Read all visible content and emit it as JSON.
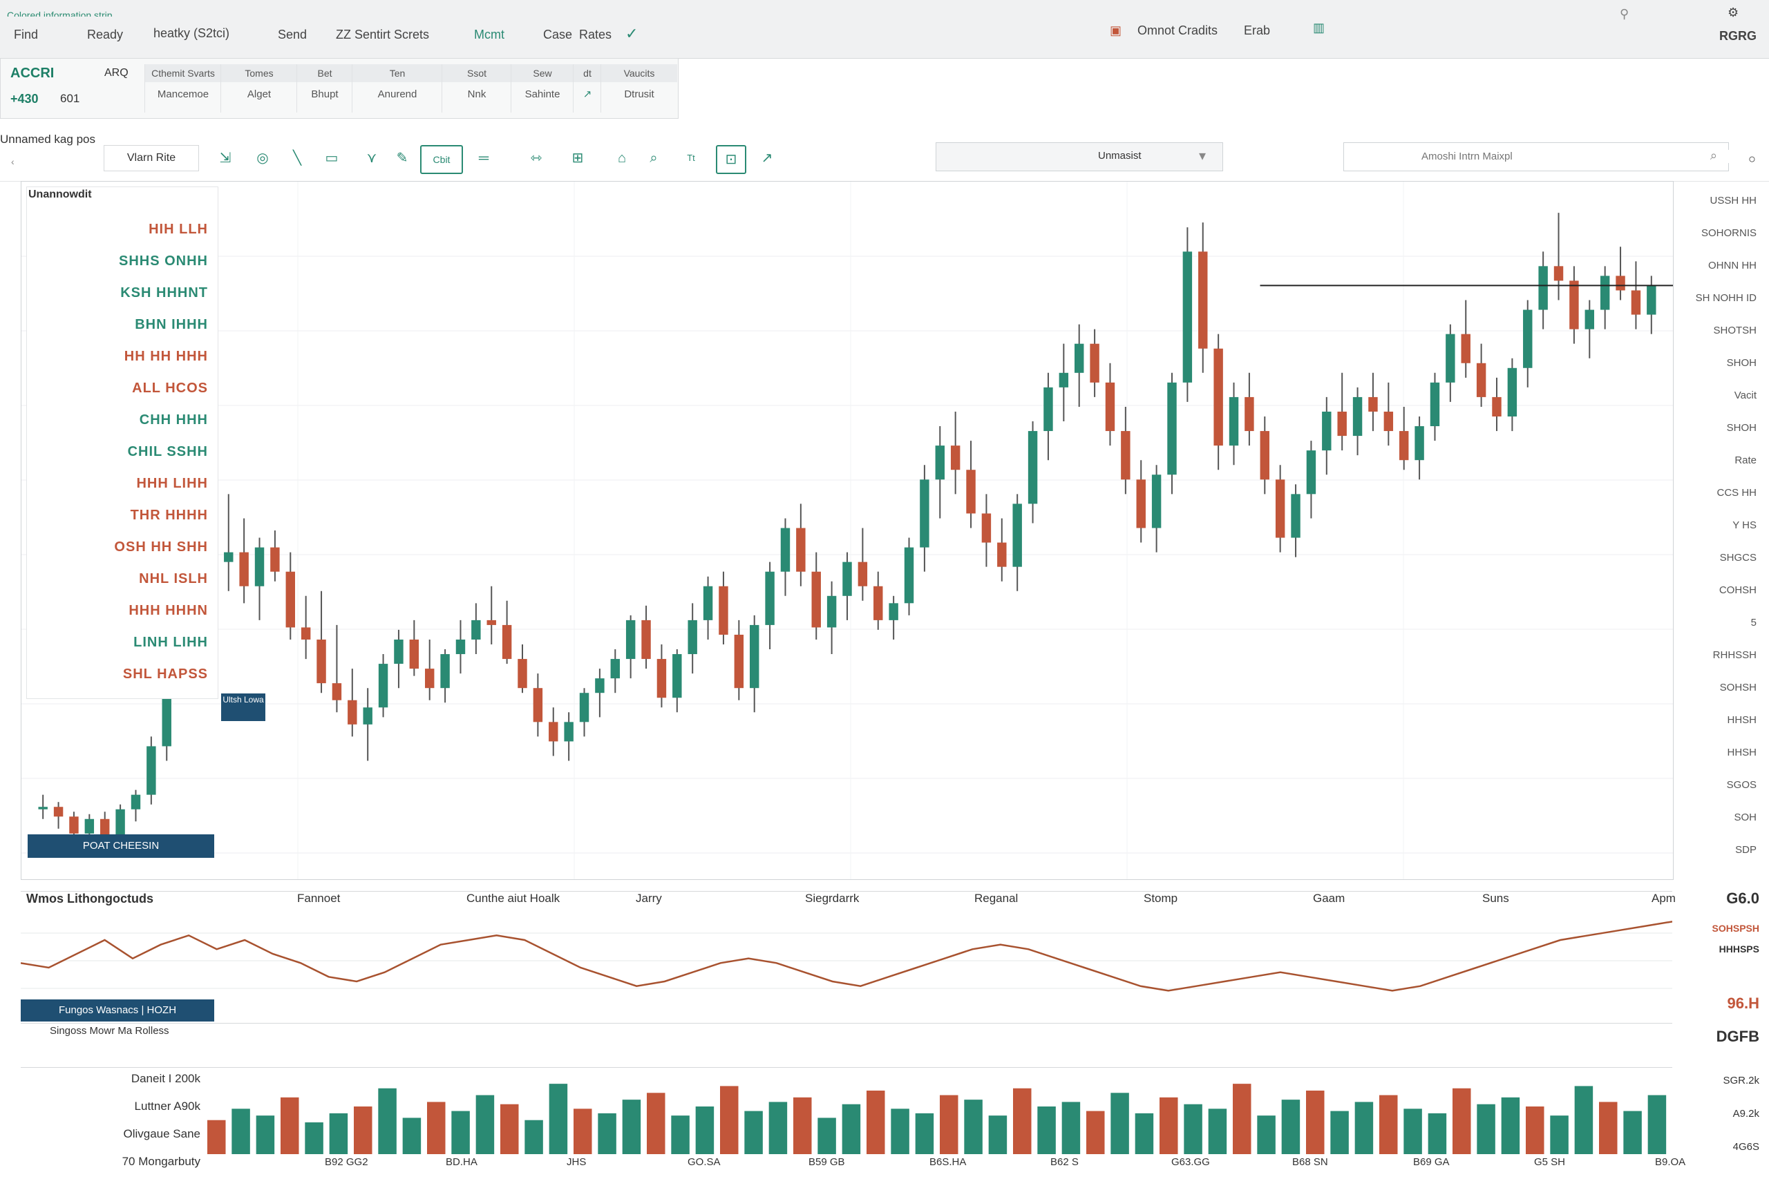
{
  "topbar": {
    "brand_strip": "Colored information strip",
    "menu": [
      "Find",
      "Ready",
      "heatky (S2tci)",
      "Send",
      "ZZ Sentirt Screts",
      "Mcmt",
      "Case",
      "Rates"
    ],
    "center_label": "Omnot Cradits",
    "center_num": "Erab",
    "right_label": "RGRG"
  },
  "quote": {
    "symbol": "ACCRI",
    "symbol_sub": "ARQ",
    "value1": "+430",
    "value2": "601",
    "headers": [
      "Cthemit Svarts",
      "Tomes",
      "Bet",
      "Ten",
      "Ssot",
      "Sew",
      "dt",
      "",
      "Vaucits"
    ],
    "values": [
      "Mancemoe",
      "Alget",
      "Bhupt",
      "Anurend",
      "Nnk",
      "Sahinte",
      "",
      "",
      "Dtrusit"
    ]
  },
  "toolbar": {
    "left_label": "Unnamed kag pos",
    "tab_label": "Vlarn Rite",
    "buttons": [
      "drag-tool",
      "crosshair-tool",
      "trend-line-tool",
      "rect-tool",
      "fib-tool",
      "pencil-tool",
      "Cbit",
      "ruler-tool",
      "measure-tool",
      "zoom-in-tool",
      "brush-tool",
      "magnet-tool",
      "text-tool",
      "lock-tool",
      "arrow-tool"
    ],
    "active_label": "Cbit",
    "dropdown_label": "Unmasist",
    "search_placeholder": "Amoshi Intrn Maixpl"
  },
  "legend": {
    "title": "Unannowdit",
    "rows": [
      {
        "text": "HIH LLH",
        "color": "#c2563a"
      },
      {
        "text": "SHHS ONHH",
        "color": "#2a8a73"
      },
      {
        "text": "KSH HHHNT",
        "color": "#2a8a73"
      },
      {
        "text": "BHN IHHH",
        "color": "#2a8a73"
      },
      {
        "text": "HH HH HHH",
        "color": "#c2563a"
      },
      {
        "text": "ALL HCOS",
        "color": "#c2563a"
      },
      {
        "text": "CHH HHH",
        "color": "#2a8a73"
      },
      {
        "text": "CHIL SSHH",
        "color": "#2a8a73"
      },
      {
        "text": "HHH LIHH",
        "color": "#c2563a"
      },
      {
        "text": "THR HHHH",
        "color": "#c2563a"
      },
      {
        "text": "OSH HH SHH",
        "color": "#c2563a"
      },
      {
        "text": "NHL ISLH",
        "color": "#c2563a"
      },
      {
        "text": "HHH HHHN",
        "color": "#c2563a"
      },
      {
        "text": "LINH LIHH",
        "color": "#2a8a73"
      },
      {
        "text": "SHL HAPSS",
        "color": "#c2563a"
      }
    ],
    "tag": "Ultsh Lowa",
    "bottom_badge": "POAT CHEESIN"
  },
  "right_axis": {
    "labels": [
      "USSH HH",
      "SOHORNIS",
      "OHNN HH",
      "SH NOHH ID",
      "SHOTSH",
      "SHOH",
      "Vacit",
      "SHOH",
      "Rate",
      "CCS HH",
      "Y HS",
      "SHGCS",
      "COHSH",
      "5",
      "RHHSSH",
      "SOHSH",
      "HHSH",
      "HHSH",
      "SGOS",
      "SOH",
      "SDP"
    ]
  },
  "indicator": {
    "title": "Wmos Lithongoctuds",
    "labels": [
      "Fannoet",
      "Cunthe aiut Hoalk",
      "Jarry",
      "Siegrdarrk",
      "Reganal",
      "Stomp",
      "Gaam",
      "Suns",
      "Apm"
    ],
    "badge_left": "Fungos Wasnacs",
    "badge_right": "HOZH",
    "note": "Singoss Mowr Ma Rolless",
    "right_values": [
      "G6.0",
      "SOHSPSH",
      "HHHSPS",
      "96.H",
      "DGFB"
    ]
  },
  "volume": {
    "labels": [
      "Daneit I 200k",
      "Luttner A90k",
      "Olivgaue Sane",
      "70 Mongarbuty"
    ],
    "xticks": [
      "B92 GG2",
      "BD.HA",
      "JHS",
      "GO.SA",
      "B59 GB",
      "B6S.HA",
      "B62 S",
      "G63.GG",
      "B68 SN",
      "B69 GA",
      "G5 SH",
      "B9.OA"
    ],
    "right_labels": [
      "SGR.2k",
      "A9.2k",
      "4G6S"
    ]
  },
  "chart_data": {
    "type": "candlestick",
    "candles": [
      [
        120,
        126,
        116,
        121
      ],
      [
        121,
        123,
        112,
        117
      ],
      [
        117,
        119,
        108,
        110
      ],
      [
        110,
        118,
        106,
        116
      ],
      [
        116,
        119,
        104,
        106
      ],
      [
        106,
        122,
        104,
        120
      ],
      [
        120,
        128,
        115,
        126
      ],
      [
        126,
        150,
        122,
        146
      ],
      [
        146,
        180,
        140,
        176
      ],
      [
        176,
        205,
        168,
        200
      ],
      [
        200,
        240,
        190,
        210
      ],
      [
        210,
        232,
        196,
        222
      ],
      [
        222,
        250,
        210,
        226
      ],
      [
        226,
        240,
        205,
        212
      ],
      [
        212,
        232,
        198,
        228
      ],
      [
        228,
        235,
        214,
        218
      ],
      [
        218,
        226,
        190,
        195
      ],
      [
        195,
        208,
        182,
        190
      ],
      [
        190,
        210,
        168,
        172
      ],
      [
        172,
        196,
        160,
        165
      ],
      [
        165,
        178,
        150,
        155
      ],
      [
        155,
        170,
        140,
        162
      ],
      [
        162,
        184,
        158,
        180
      ],
      [
        180,
        194,
        170,
        190
      ],
      [
        190,
        198,
        175,
        178
      ],
      [
        178,
        190,
        165,
        170
      ],
      [
        170,
        186,
        164,
        184
      ],
      [
        184,
        198,
        176,
        190
      ],
      [
        190,
        205,
        184,
        198
      ],
      [
        198,
        212,
        188,
        196
      ],
      [
        196,
        206,
        180,
        182
      ],
      [
        182,
        188,
        168,
        170
      ],
      [
        170,
        176,
        150,
        156
      ],
      [
        156,
        162,
        142,
        148
      ],
      [
        148,
        160,
        140,
        156
      ],
      [
        156,
        170,
        150,
        168
      ],
      [
        168,
        178,
        158,
        174
      ],
      [
        174,
        186,
        168,
        182
      ],
      [
        182,
        200,
        174,
        198
      ],
      [
        198,
        204,
        178,
        182
      ],
      [
        182,
        188,
        162,
        166
      ],
      [
        166,
        186,
        160,
        184
      ],
      [
        184,
        205,
        176,
        198
      ],
      [
        198,
        216,
        190,
        212
      ],
      [
        212,
        218,
        188,
        192
      ],
      [
        192,
        198,
        165,
        170
      ],
      [
        170,
        200,
        160,
        196
      ],
      [
        196,
        222,
        186,
        218
      ],
      [
        218,
        240,
        208,
        236
      ],
      [
        236,
        246,
        212,
        218
      ],
      [
        218,
        226,
        190,
        195
      ],
      [
        195,
        214,
        184,
        208
      ],
      [
        208,
        226,
        198,
        222
      ],
      [
        222,
        236,
        206,
        212
      ],
      [
        212,
        218,
        194,
        198
      ],
      [
        198,
        208,
        190,
        205
      ],
      [
        205,
        232,
        200,
        228
      ],
      [
        228,
        262,
        218,
        256
      ],
      [
        256,
        278,
        240,
        270
      ],
      [
        270,
        284,
        250,
        260
      ],
      [
        260,
        272,
        236,
        242
      ],
      [
        242,
        250,
        220,
        230
      ],
      [
        230,
        240,
        214,
        220
      ],
      [
        220,
        250,
        210,
        246
      ],
      [
        246,
        280,
        238,
        276
      ],
      [
        276,
        300,
        264,
        294
      ],
      [
        294,
        312,
        280,
        300
      ],
      [
        300,
        320,
        286,
        312
      ],
      [
        312,
        318,
        290,
        296
      ],
      [
        296,
        304,
        270,
        276
      ],
      [
        276,
        286,
        250,
        256
      ],
      [
        256,
        264,
        230,
        236
      ],
      [
        236,
        262,
        226,
        258
      ],
      [
        258,
        300,
        250,
        296
      ],
      [
        296,
        360,
        288,
        350
      ],
      [
        350,
        362,
        300,
        310
      ],
      [
        310,
        316,
        260,
        270
      ],
      [
        270,
        296,
        262,
        290
      ],
      [
        290,
        300,
        270,
        276
      ],
      [
        276,
        282,
        250,
        256
      ],
      [
        256,
        262,
        226,
        232
      ],
      [
        232,
        254,
        224,
        250
      ],
      [
        250,
        272,
        240,
        268
      ],
      [
        268,
        290,
        258,
        284
      ],
      [
        284,
        300,
        268,
        274
      ],
      [
        274,
        294,
        266,
        290
      ],
      [
        290,
        300,
        276,
        284
      ],
      [
        284,
        296,
        270,
        276
      ],
      [
        276,
        286,
        260,
        264
      ],
      [
        264,
        282,
        256,
        278
      ],
      [
        278,
        300,
        272,
        296
      ],
      [
        296,
        320,
        288,
        316
      ],
      [
        316,
        330,
        298,
        304
      ],
      [
        304,
        312,
        286,
        290
      ],
      [
        290,
        298,
        276,
        282
      ],
      [
        282,
        306,
        276,
        302
      ],
      [
        302,
        330,
        294,
        326
      ],
      [
        326,
        350,
        318,
        344
      ],
      [
        344,
        366,
        330,
        338
      ],
      [
        338,
        344,
        312,
        318
      ],
      [
        318,
        330,
        306,
        326
      ],
      [
        326,
        344,
        318,
        340
      ],
      [
        340,
        352,
        330,
        334
      ],
      [
        334,
        346,
        318,
        324
      ],
      [
        324,
        340,
        316,
        336
      ]
    ]
  },
  "indicator_data": [
    50,
    48,
    54,
    60,
    52,
    58,
    62,
    56,
    60,
    54,
    50,
    44,
    42,
    46,
    52,
    58,
    60,
    62,
    60,
    54,
    48,
    44,
    40,
    42,
    46,
    50,
    52,
    50,
    46,
    42,
    40,
    44,
    48,
    52,
    56,
    58,
    56,
    52,
    48,
    44,
    40,
    38,
    40,
    42,
    44,
    46,
    44,
    42,
    40,
    38,
    40,
    44,
    48,
    52,
    56,
    60,
    62,
    64,
    66,
    68
  ],
  "volume_data": [
    30,
    40,
    34,
    50,
    28,
    36,
    42,
    58,
    32,
    46,
    38,
    52,
    44,
    30,
    62,
    40,
    36,
    48,
    54,
    34,
    42,
    60,
    38,
    46,
    50,
    32,
    44,
    56,
    40,
    36,
    52,
    48,
    34,
    58,
    42,
    46,
    38,
    54,
    36,
    50,
    44,
    40,
    62,
    34,
    48,
    56,
    38,
    46,
    52,
    40,
    36,
    58,
    44,
    50,
    42,
    34,
    60,
    46,
    38,
    52
  ]
}
